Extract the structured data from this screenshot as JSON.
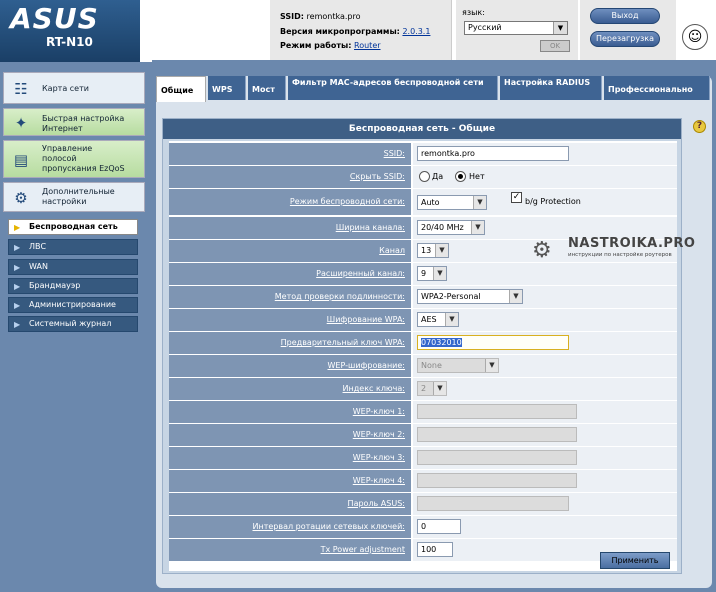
{
  "header": {
    "brand": "ASUS",
    "model": "RT-N10",
    "ssid_label": "SSID:",
    "ssid_value": "remontka.pro",
    "firmware_label": "Версия микропрограммы:",
    "firmware_value": "2.0.3.1",
    "mode_label": "Режим работы:",
    "mode_value": "Router",
    "language_label": "язык:",
    "language_value": "Русский",
    "ok_label": "OK",
    "logout_label": "Выход",
    "reboot_label": "Перезагрузка"
  },
  "sidebar": {
    "big_items": [
      {
        "label": "Карта сети"
      },
      {
        "label": "Быстрая настройка Интернет"
      },
      {
        "label": "Управление полосой пропускания EzQoS"
      },
      {
        "label": "Дополнительные настройки"
      }
    ],
    "sub_items": [
      {
        "label": "Беспроводная сеть"
      },
      {
        "label": "ЛВС"
      },
      {
        "label": "WAN"
      },
      {
        "label": "Брандмауэр"
      },
      {
        "label": "Администрирование"
      },
      {
        "label": "Системный журнал"
      }
    ]
  },
  "tabs": [
    {
      "label": "Общие"
    },
    {
      "label": "WPS"
    },
    {
      "label": "Мост"
    },
    {
      "label": "Фильтр MAC-адресов беспроводной сети"
    },
    {
      "label": "Настройка RADIUS"
    },
    {
      "label": "Профессионально"
    }
  ],
  "form": {
    "title": "Беспроводная сеть - Общие",
    "ssid_label": "SSID:",
    "ssid_value": "remontka.pro",
    "hide_ssid_label": "Скрыть SSID:",
    "hide_yes": "Да",
    "hide_no": "Нет",
    "wireless_mode_label": "Режим беспроводной сети:",
    "wireless_mode_value": "Auto",
    "bg_protection_label": "b/g Protection",
    "channel_width_label": "Ширина канала:",
    "channel_width_value": "20/40 MHz",
    "channel_label": "Канал",
    "channel_value": "13",
    "ext_channel_label": "Расширенный канал:",
    "ext_channel_value": "9",
    "auth_label": "Метод проверки подлинности:",
    "auth_value": "WPA2-Personal",
    "wpa_enc_label": "Шифрование WPA:",
    "wpa_enc_value": "AES",
    "wpa_key_label": "Предварительный ключ WPA:",
    "wpa_key_value": "07032010",
    "wep_enc_label": "WEP-шифрование:",
    "wep_enc_value": "None",
    "key_index_label": "Индекс ключа:",
    "key_index_value": "2",
    "wep1_label": "WEP-ключ 1:",
    "wep2_label": "WEP-ключ 2:",
    "wep3_label": "WEP-ключ 3:",
    "wep4_label": "WEP-ключ 4:",
    "asus_pass_label": "Пароль ASUS:",
    "rotation_label": "Интервал ротации сетевых ключей:",
    "rotation_value": "0",
    "tx_power_label": "Tx Power adjustment",
    "tx_power_value": "100",
    "apply_label": "Применить"
  },
  "watermark": {
    "title": "NASTROIKA.PRO",
    "subtitle": "инструкции по настройке роутеров"
  },
  "help_icon": "?",
  "colors": {
    "nav_blue": "#3f6493",
    "label_bg": "#7e95b3",
    "sidebar_bg": "#6b88ad",
    "title_bar": "#3e5f86"
  }
}
